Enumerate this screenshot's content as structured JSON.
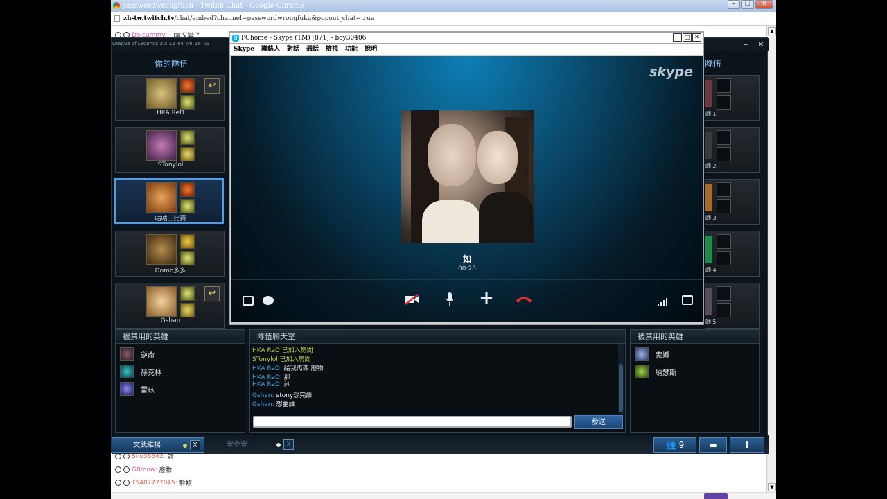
{
  "chrome": {
    "title": "passwordwrongfuku - Twitch Chat - Google Chrome",
    "url_host": "zh-tw.twitch.tv",
    "url_path": "/chat/embed?channel=passwordwrongfuku&popout_chat=true",
    "chat_top": {
      "user": "Dolcummy:",
      "text": "口氣又變了"
    },
    "chat_lines": [
      {
        "user": "Sho36642:",
        "text": "幹"
      },
      {
        "user": "G8mow:",
        "text": "廢物"
      },
      {
        "user": "T5407777045:",
        "text": "幹欸"
      }
    ]
  },
  "lol": {
    "version": "League of Legends 3.5.13_04_08_16_09",
    "your_team_title": "你的隊伍",
    "enemy_team_title": "隊伍",
    "players": [
      {
        "name": "HKA ReD",
        "swap": true
      },
      {
        "name": "STonylol",
        "swap": false
      },
      {
        "name": "咕咕三比賽",
        "swap": false,
        "active": true
      },
      {
        "name": "Domo多多",
        "swap": false
      },
      {
        "name": "Gshan",
        "swap": true
      }
    ],
    "enemy_labels": [
      "師 1",
      "師 2",
      "師 3",
      "師 4",
      "師 5"
    ],
    "banned_title_left": "被禁用的英雄",
    "banned_left": [
      "逆命",
      "赫克林",
      "雷茲"
    ],
    "banned_title_right": "被禁用的英雄",
    "banned_right": [
      "索娜",
      "納瑟斯"
    ],
    "team_chat_title": "隊伍聊天室",
    "team_chat": [
      {
        "sys": "HKA ReD 已加入房間"
      },
      {
        "sys": "STonylol 已加入房間"
      },
      {
        "who": "HKA ReD:",
        "text": "給我杰西 廢物"
      },
      {
        "who": "HKA ReD:",
        "text": "那"
      },
      {
        "who": "HKA ReD:",
        "text": "j4"
      },
      {
        "who": "Gshan:",
        "text": "stony想完誰"
      },
      {
        "who": "Gshan:",
        "text": "想要誰"
      }
    ],
    "send_label": "發送",
    "chat_tabs": [
      {
        "label": "文武維揚",
        "dot": "#c9e06a"
      },
      {
        "label": "宋小宋",
        "dot": "#e6ecf0"
      }
    ],
    "friends_count": "9",
    "alert_label": "!"
  },
  "skype": {
    "title": "PChome - Skype (TM) [871] - boy30406",
    "menu": [
      "Skype",
      "聯絡人",
      "對話",
      "通話",
      "檢視",
      "功能",
      "說明"
    ],
    "logo": "skype",
    "caller_name": "如",
    "call_time": "00:28"
  }
}
